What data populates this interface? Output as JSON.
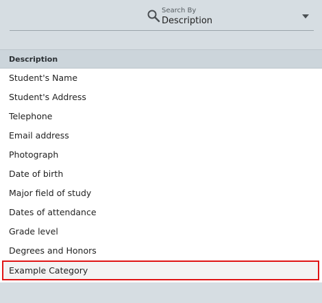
{
  "search": {
    "label": "Search By",
    "value": "Description"
  },
  "table": {
    "column_header": "Description",
    "rows": [
      "Student's Name",
      "Student's Address",
      "Telephone",
      "Email address",
      "Photograph",
      "Date of birth",
      "Major field of study",
      "Dates of attendance",
      "Grade level",
      "Degrees and Honors",
      "Example Category"
    ],
    "selected_row": "Example Category"
  },
  "colors": {
    "background": "#d6dde2",
    "header_background": "#ccd5db",
    "list_background": "#ffffff",
    "selection_outline": "#e01414"
  },
  "icons": {
    "search": "search-icon",
    "dropdown": "chevron-down-icon"
  }
}
